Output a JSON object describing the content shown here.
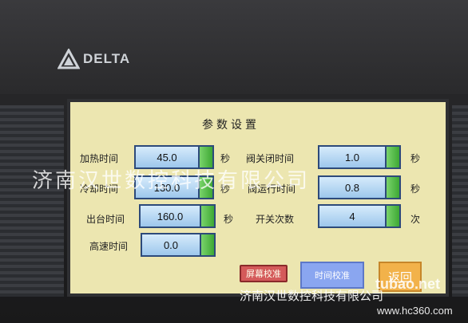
{
  "brand": {
    "logo_text": "DELTA"
  },
  "screen": {
    "title": "参数设置",
    "left_params": [
      {
        "label": "加热时间",
        "value": "45.0",
        "unit": "秒"
      },
      {
        "label": "冷却时间",
        "value": "130.0",
        "unit": "秒"
      },
      {
        "label": "出台时间",
        "value": "160.0",
        "unit": "秒"
      },
      {
        "label": "高速时间",
        "value": "0.0"
      }
    ],
    "right_params": [
      {
        "label": "阀关闭时间",
        "value": "1.0",
        "unit": "秒"
      },
      {
        "label": "阀运行时间",
        "value": "0.8",
        "unit": "秒"
      },
      {
        "label": "开关次数",
        "value": "4",
        "unit": "次"
      }
    ],
    "buttons": {
      "calibrate": "屏幕校准",
      "time_calibrate": "时间校准",
      "back": "返回"
    }
  },
  "watermarks": {
    "company_large": "济南汉世数控科技有限公司",
    "company_bottom": "济南汉世数控科技有限公司",
    "tubao": "tubao.net",
    "site": "www.hc360.com"
  }
}
